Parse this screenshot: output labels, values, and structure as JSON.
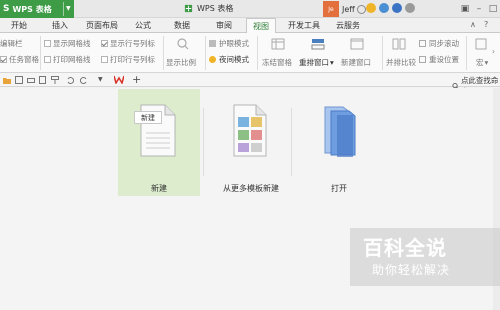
{
  "titlebar": {
    "app_logo": "S",
    "app_name": "WPS 表格",
    "window_title": "WPS 表格",
    "user_avatar": "Je",
    "user_name": "Jeff"
  },
  "menu": {
    "tabs": [
      "开始",
      "插入",
      "页面布局",
      "公式",
      "数据",
      "审阅",
      "视图",
      "开发工具",
      "云服务"
    ],
    "active_tab": "视图"
  },
  "ribbon": {
    "edit_bar": "编辑栏",
    "task_pane": "任务窗格",
    "show_grid": "显示网格线",
    "show_headers": "显示行号列标",
    "print_grid": "打印网格线",
    "print_headers": "打印行号列标",
    "zoom": "显示比例",
    "eye_mode": "护眼模式",
    "night_mode": "夜间模式",
    "freeze": "冻结窗格",
    "rearrange": "重排窗口",
    "new_window": "新建窗口",
    "side_by_side": "并排比较",
    "sync_scroll": "同步滚动",
    "reset_pos": "重设位置",
    "macro": "宏"
  },
  "toolbar": {
    "search_hint": "点此查找命令",
    "add_tab": "+"
  },
  "start": {
    "doc_icon_label": "新建",
    "tiles": [
      {
        "label": "新建"
      },
      {
        "label": "从更多模板新建"
      },
      {
        "label": "打开"
      }
    ]
  },
  "watermark": {
    "title": "百科全说",
    "subtitle": "助你轻松解决"
  },
  "colors": {
    "accent_green": "#3e9b46",
    "active_tile": "#dceccd",
    "avatar": "#e36f3c"
  }
}
